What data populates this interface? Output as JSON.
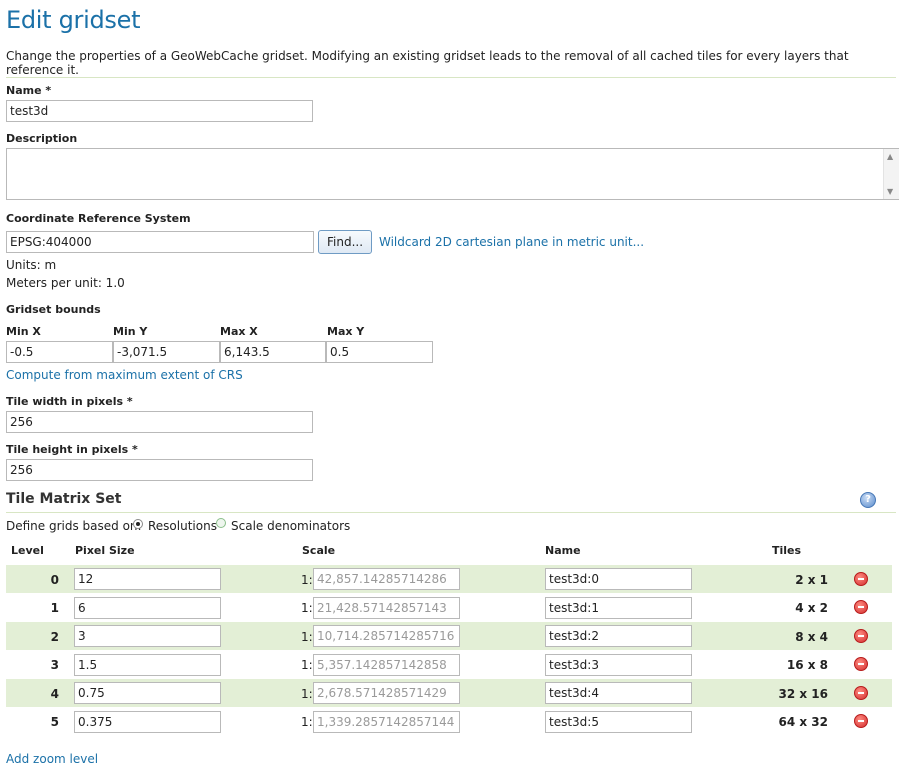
{
  "page": {
    "title": "Edit gridset",
    "intro": "Change the properties of a GeoWebCache gridset. Modifying an existing gridset leads to the removal of all cached tiles for every layers that reference it."
  },
  "form": {
    "name_label": "Name *",
    "name_value": "test3d",
    "description_label": "Description",
    "description_value": "",
    "crs_label": "Coordinate Reference System",
    "crs_value": "EPSG:404000",
    "find_button": "Find...",
    "crs_description_link": "Wildcard 2D cartesian plane in metric unit...",
    "units": "Units: m",
    "meters_per_unit": "Meters per unit: 1.0",
    "bounds_label": "Gridset bounds",
    "bounds": {
      "minx_label": "Min X",
      "minx_value": "-0.5",
      "miny_label": "Min Y",
      "miny_value": "-3,071.5",
      "maxx_label": "Max X",
      "maxx_value": "6,143.5",
      "maxy_label": "Max Y",
      "maxy_value": "0.5"
    },
    "compute_link": "Compute from maximum extent of CRS",
    "tile_width_label": "Tile width in pixels *",
    "tile_width_value": "256",
    "tile_height_label": "Tile height in pixels *",
    "tile_height_value": "256"
  },
  "matrix": {
    "title": "Tile Matrix Set",
    "help_icon": "help-icon",
    "define_label": "Define grids based on:",
    "option_resolutions": "Resolutions",
    "option_scales": "Scale denominators",
    "selected_option": "Resolutions",
    "columns": {
      "level": "Level",
      "pixel_size": "Pixel Size",
      "scale": "Scale",
      "name": "Name",
      "tiles": "Tiles"
    },
    "scale_prefix": "1:",
    "rows": [
      {
        "level": "0",
        "pixel_size": "12",
        "scale": "42,857.14285714286",
        "name": "test3d:0",
        "tiles": "2 x 1"
      },
      {
        "level": "1",
        "pixel_size": "6",
        "scale": "21,428.57142857143",
        "name": "test3d:1",
        "tiles": "4 x 2"
      },
      {
        "level": "2",
        "pixel_size": "3",
        "scale": "10,714.285714285716",
        "name": "test3d:2",
        "tiles": "8 x 4"
      },
      {
        "level": "3",
        "pixel_size": "1.5",
        "scale": "5,357.142857142858",
        "name": "test3d:3",
        "tiles": "16 x 8"
      },
      {
        "level": "4",
        "pixel_size": "0.75",
        "scale": "2,678.571428571429",
        "name": "test3d:4",
        "tiles": "32 x 16"
      },
      {
        "level": "5",
        "pixel_size": "0.375",
        "scale": "1,339.2857142857144",
        "name": "test3d:5",
        "tiles": "64 x 32"
      }
    ],
    "add_zoom_link": "Add zoom level"
  },
  "colors": {
    "title_blue": "#1b71a8",
    "row_alt_green": "#e3efd6",
    "remove_red": "#d32f2f"
  }
}
